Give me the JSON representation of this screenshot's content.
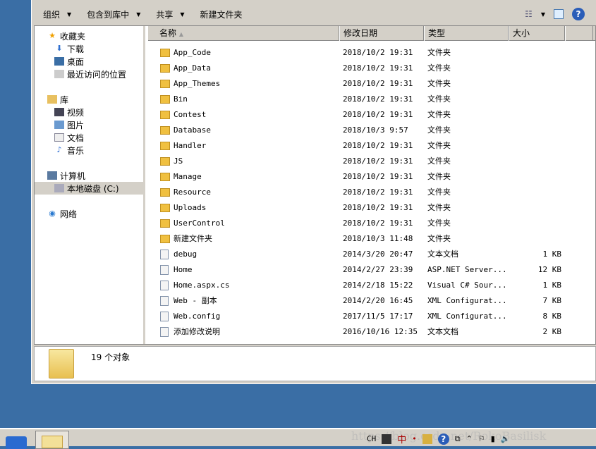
{
  "toolbar": {
    "organize": "组织",
    "include_library": "包含到库中",
    "share": "共享",
    "new_folder": "新建文件夹",
    "help": "?"
  },
  "sidebar": {
    "favorites": "收藏夹",
    "downloads": "下载",
    "desktop": "桌面",
    "recent": "最近访问的位置",
    "libraries": "库",
    "videos": "视频",
    "pictures": "图片",
    "documents": "文档",
    "music": "音乐",
    "computer": "计算机",
    "local_disk": "本地磁盘 (C:)",
    "network": "网络"
  },
  "columns": {
    "name": "名称",
    "modified": "修改日期",
    "type": "类型",
    "size": "大小"
  },
  "files": [
    {
      "name": "App_Code",
      "date": "2018/10/2 19:31",
      "type": "文件夹",
      "size": "",
      "kind": "folder"
    },
    {
      "name": "App_Data",
      "date": "2018/10/2 19:31",
      "type": "文件夹",
      "size": "",
      "kind": "folder"
    },
    {
      "name": "App_Themes",
      "date": "2018/10/2 19:31",
      "type": "文件夹",
      "size": "",
      "kind": "folder"
    },
    {
      "name": "Bin",
      "date": "2018/10/2 19:31",
      "type": "文件夹",
      "size": "",
      "kind": "folder"
    },
    {
      "name": "Contest",
      "date": "2018/10/2 19:31",
      "type": "文件夹",
      "size": "",
      "kind": "folder"
    },
    {
      "name": "Database",
      "date": "2018/10/3 9:57",
      "type": "文件夹",
      "size": "",
      "kind": "folder"
    },
    {
      "name": "Handler",
      "date": "2018/10/2 19:31",
      "type": "文件夹",
      "size": "",
      "kind": "folder"
    },
    {
      "name": "JS",
      "date": "2018/10/2 19:31",
      "type": "文件夹",
      "size": "",
      "kind": "folder"
    },
    {
      "name": "Manage",
      "date": "2018/10/2 19:31",
      "type": "文件夹",
      "size": "",
      "kind": "folder"
    },
    {
      "name": "Resource",
      "date": "2018/10/2 19:31",
      "type": "文件夹",
      "size": "",
      "kind": "folder"
    },
    {
      "name": "Uploads",
      "date": "2018/10/2 19:31",
      "type": "文件夹",
      "size": "",
      "kind": "folder"
    },
    {
      "name": "UserControl",
      "date": "2018/10/2 19:31",
      "type": "文件夹",
      "size": "",
      "kind": "folder"
    },
    {
      "name": "新建文件夹",
      "date": "2018/10/3 11:48",
      "type": "文件夹",
      "size": "",
      "kind": "folder"
    },
    {
      "name": "debug",
      "date": "2014/3/20 20:47",
      "type": "文本文档",
      "size": "1 KB",
      "kind": "file"
    },
    {
      "name": "Home",
      "date": "2014/2/27 23:39",
      "type": "ASP.NET Server...",
      "size": "12 KB",
      "kind": "file"
    },
    {
      "name": "Home.aspx.cs",
      "date": "2014/2/18 15:22",
      "type": "Visual C# Sour...",
      "size": "1 KB",
      "kind": "file"
    },
    {
      "name": "Web - 副本",
      "date": "2014/2/20 16:45",
      "type": "XML Configurat...",
      "size": "7 KB",
      "kind": "file"
    },
    {
      "name": "Web.config",
      "date": "2017/11/5 17:17",
      "type": "XML Configurat...",
      "size": "8 KB",
      "kind": "file"
    },
    {
      "name": "添加修改说明",
      "date": "2016/10/16 12:35",
      "type": "文本文档",
      "size": "2 KB",
      "kind": "file"
    }
  ],
  "status": {
    "count": "19 个对象"
  },
  "taskbar": {
    "lang": "CH",
    "ime": "中",
    "watermark": "https://blog.csdn.net/RokoBasilisk"
  }
}
